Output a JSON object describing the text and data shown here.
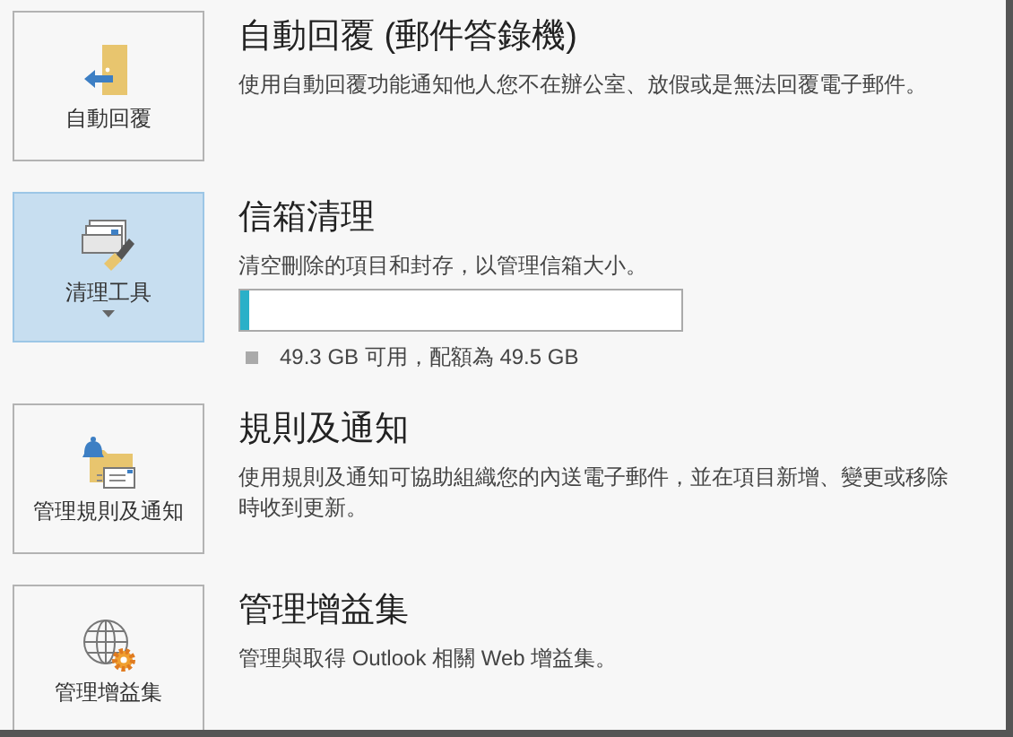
{
  "sections": [
    {
      "kind": "auto-reply",
      "button_label": "自動回覆",
      "highlighted": false,
      "has_menu": false,
      "title": "自動回覆 (郵件答錄機)",
      "description": "使用自動回覆功能通知他人您不在辦公室、放假或是無法回覆電子郵件。"
    },
    {
      "kind": "cleanup",
      "button_label": "清理工具",
      "highlighted": true,
      "has_menu": true,
      "title": "信箱清理",
      "description": "清空刪除的項目和封存，以管理信箱大小。",
      "quota": {
        "level": 0.02,
        "reading": "49.3 GB 可用，配額為 49.5 GB"
      }
    },
    {
      "kind": "rules",
      "button_label": "管理規則及通知",
      "highlighted": false,
      "has_menu": false,
      "title": "規則及通知",
      "description": "使用規則及通知可協助組織您的內送電子郵件，並在項目新增、變更或移除時收到更新。"
    },
    {
      "kind": "addins",
      "button_label": "管理增益集",
      "highlighted": false,
      "has_menu": false,
      "title": "管理增益集",
      "description": "管理與取得 Outlook 相關 Web 增益集。"
    }
  ]
}
